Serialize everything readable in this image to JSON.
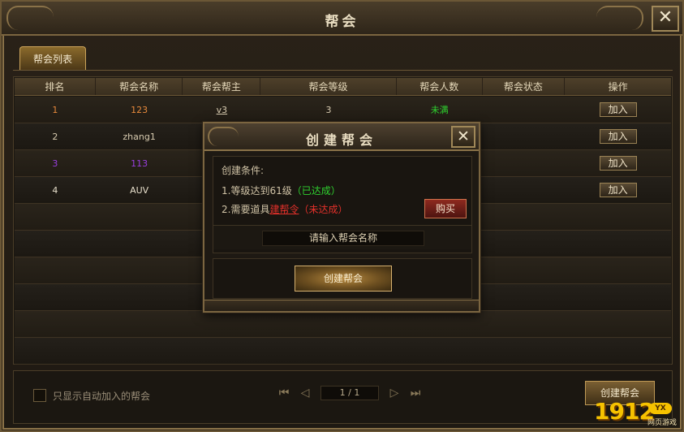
{
  "window": {
    "title": "帮会",
    "close_label": "✕"
  },
  "tabs": [
    {
      "label": "帮会列表"
    }
  ],
  "table": {
    "headers": [
      "排名",
      "帮会名称",
      "帮会帮主",
      "帮会等级",
      "帮会人数",
      "帮会状态",
      "操作"
    ],
    "rows": [
      {
        "rank": "1",
        "name": "123",
        "leader": "v3",
        "level": "3",
        "members": "未满",
        "status": "",
        "action": "加入",
        "color": "#e88a3c"
      },
      {
        "rank": "2",
        "name": "zhang1",
        "leader": "",
        "level": "",
        "members": "",
        "status": "",
        "action": "加入",
        "color": "#d8cbb0"
      },
      {
        "rank": "3",
        "name": "113",
        "leader": "",
        "level": "",
        "members": "",
        "status": "",
        "action": "加入",
        "color": "#9a3ee0"
      },
      {
        "rank": "4",
        "name": "AUV",
        "leader": "",
        "level": "",
        "members": "",
        "status": "",
        "action": "加入",
        "color": "#e8e0cc"
      }
    ],
    "members_color": "#2fd12f"
  },
  "footer": {
    "auto_join_label": "只显示自动加入的帮会",
    "page": "1 / 1",
    "first_icon": "double-left-arrow",
    "prev_icon": "left-arrow",
    "next_icon": "right-arrow",
    "last_icon": "double-right-arrow",
    "create_label": "创建帮会"
  },
  "modal": {
    "title": "创建帮会",
    "close_label": "✕",
    "conditions_title": "创建条件:",
    "cond1_prefix": "1.等级达到61级",
    "cond1_status": "（已达成）",
    "cond2_prefix": "2.需要道具",
    "cond2_item": "建帮令",
    "cond2_status": "（未达成）",
    "buy_label": "购买",
    "name_placeholder": "请输入帮会名称",
    "create_label": "创建帮会"
  },
  "watermark": {
    "logo": "1912",
    "badge": "YX",
    "sub": "网页游戏"
  }
}
